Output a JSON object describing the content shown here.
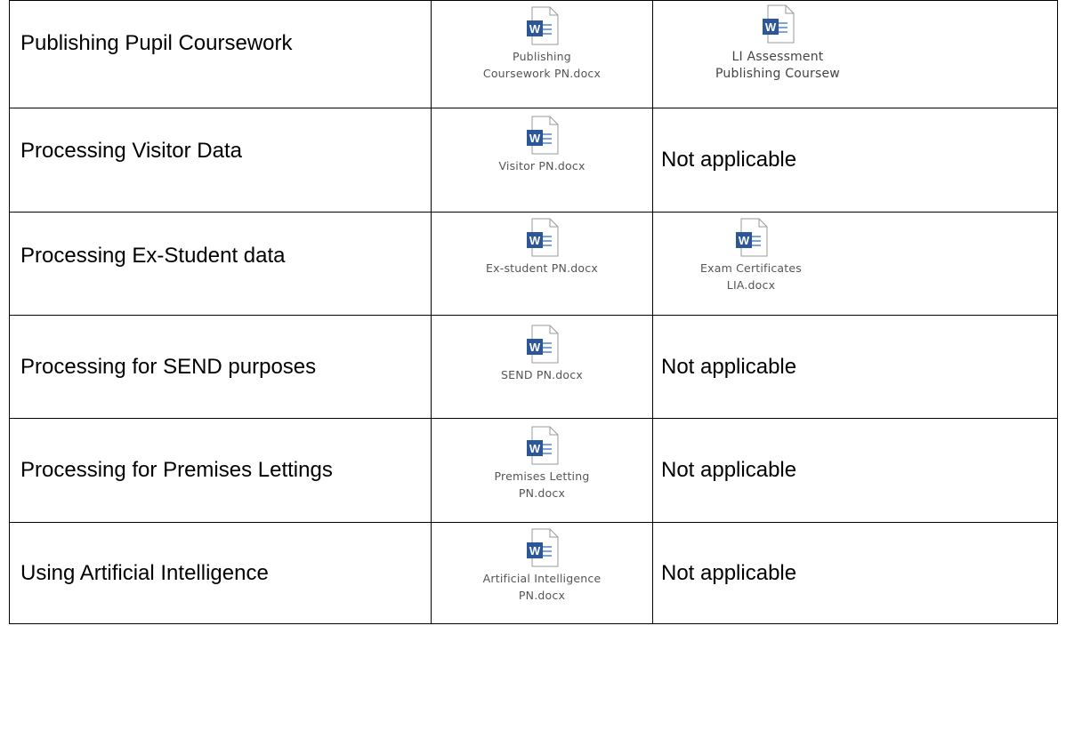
{
  "rows": [
    {
      "purpose": "Publishing Pupil Coursework",
      "notice_file": [
        "Publishing",
        "Coursework PN.docx"
      ],
      "assessment_file": [
        "LI Assessment",
        "Publishing Coursew"
      ],
      "assessment_text": ""
    },
    {
      "purpose": "Processing Visitor Data",
      "notice_file": [
        "Visitor PN.docx"
      ],
      "assessment_text": "Not applicable"
    },
    {
      "purpose": "Processing Ex-Student data",
      "notice_file": [
        "Ex-student PN.docx"
      ],
      "assessment_file": [
        "Exam Certificates",
        "LIA.docx"
      ],
      "assessment_text": ""
    },
    {
      "purpose": "Processing for SEND purposes",
      "notice_file": [
        "SEND PN.docx"
      ],
      "assessment_text": "Not applicable"
    },
    {
      "purpose": "Processing for Premises Lettings",
      "notice_file": [
        "Premises Letting",
        "PN.docx"
      ],
      "assessment_text": "Not applicable"
    },
    {
      "purpose": "Using Artificial Intelligence",
      "notice_file": [
        "Artificial Intelligence",
        "PN.docx"
      ],
      "assessment_text": "Not applicable"
    }
  ],
  "icon": {
    "name": "word-document-icon",
    "accent": "#2b579a"
  }
}
